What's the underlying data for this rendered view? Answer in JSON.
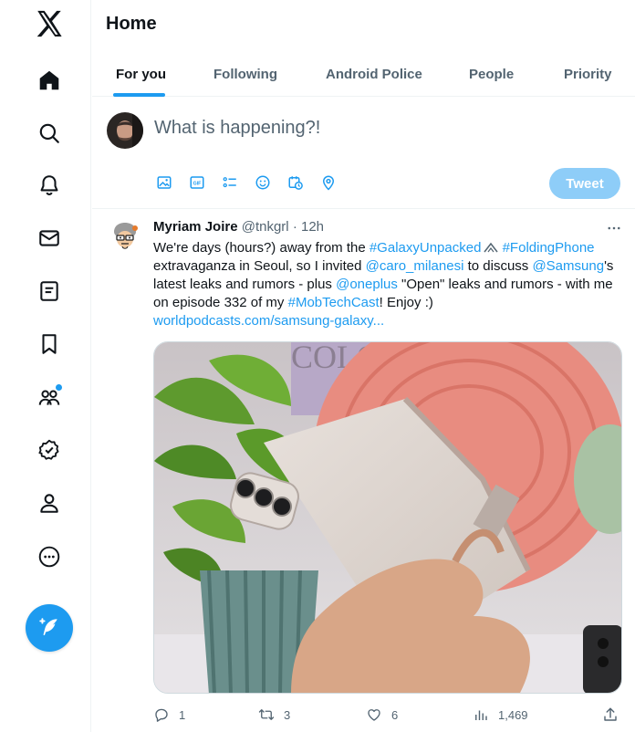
{
  "nav": {
    "items": [
      {
        "icon": "x-logo-icon"
      },
      {
        "icon": "home-icon"
      },
      {
        "icon": "search-icon"
      },
      {
        "icon": "bell-icon"
      },
      {
        "icon": "mail-icon"
      },
      {
        "icon": "lists-icon"
      },
      {
        "icon": "bookmark-icon"
      },
      {
        "icon": "communities-icon"
      },
      {
        "icon": "verified-icon"
      },
      {
        "icon": "profile-icon"
      },
      {
        "icon": "more-icon"
      }
    ],
    "compose_icon": "compose-feather-icon",
    "accent": "#1d9bf0"
  },
  "header": {
    "title": "Home"
  },
  "tabs": [
    {
      "label": "For you",
      "active": true
    },
    {
      "label": "Following",
      "active": false
    },
    {
      "label": "Android Police",
      "active": false
    },
    {
      "label": "People",
      "active": false
    },
    {
      "label": "Priority",
      "active": false
    }
  ],
  "composer": {
    "placeholder": "What is happening?!",
    "tools": [
      "image-icon",
      "gif-icon",
      "poll-icon",
      "emoji-icon",
      "schedule-icon",
      "location-icon"
    ],
    "tweet_label": "Tweet"
  },
  "tweet": {
    "author_name": "Myriam Joire",
    "author_handle": "@tnkgrl",
    "separator": "·",
    "time": "12h",
    "text": {
      "p1": "We're days (hours?) away from the ",
      "tag1": "#GalaxyUnpacked",
      "p2": " ",
      "tag2": "#FoldingPhone",
      "p3": " extravaganza in Seoul, so I invited ",
      "mention1": "@caro_milanesi",
      "p4": " to discuss ",
      "mention2": "@Samsung",
      "p5": "'s latest leaks and rumors - plus ",
      "mention3": "@oneplus",
      "p6": " \"Open\" leaks and rumors - with me on episode 332 of my ",
      "tag3": "#MobTechCast",
      "p7": "! Enjoy :)",
      "url": "worldpodcasts.com/samsung-galaxy..."
    },
    "stats": {
      "replies": "1",
      "retweets": "3",
      "likes": "6",
      "views": "1,469"
    }
  }
}
